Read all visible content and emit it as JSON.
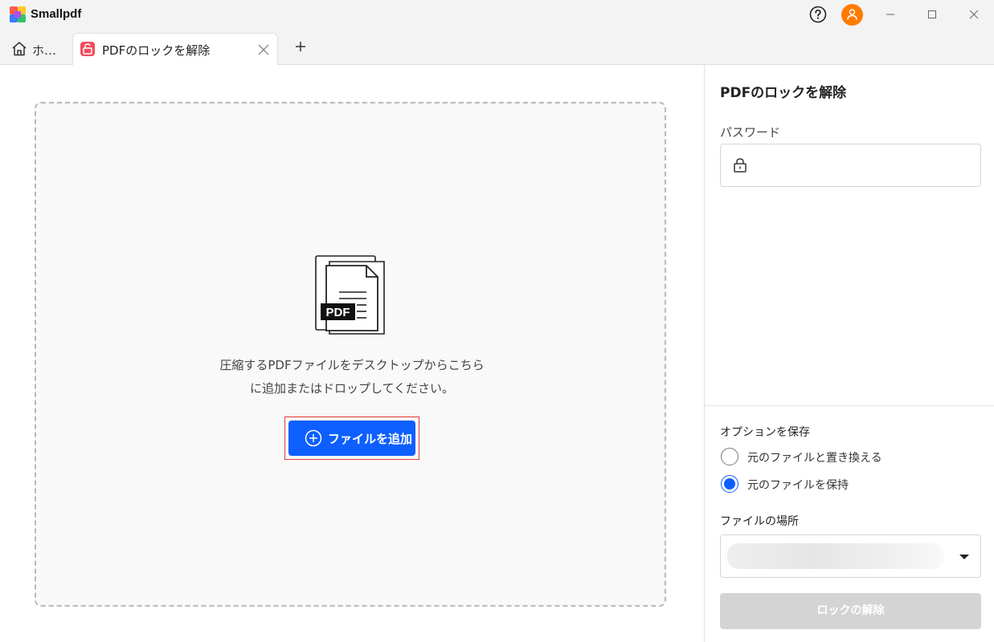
{
  "app": {
    "name": "Smallpdf"
  },
  "tabs": [
    {
      "label": "ホ…",
      "icon": "home-icon"
    },
    {
      "label": "PDFのロックを解除",
      "icon": "unlock-icon",
      "active": true
    }
  ],
  "dropzone": {
    "line1": "圧縮するPDFファイルをデスクトップからこちら",
    "line2": "に追加またはドロップしてください。",
    "illustration_text": "PDF",
    "add_button": "ファイルを追加"
  },
  "panel": {
    "title": "PDFのロックを解除",
    "password_label": "パスワード",
    "password_value": "",
    "save_options_label": "オプションを保存",
    "options": [
      {
        "label": "元のファイルと置き換える",
        "checked": false
      },
      {
        "label": "元のファイルを保持",
        "checked": true
      }
    ],
    "location_label": "ファイルの場所",
    "unlock_button": "ロックの解除"
  },
  "colors": {
    "accent": "#0d5fff",
    "avatar": "#ff7a00",
    "tab_icon": "#f04e5e",
    "disabled_button": "#d4d4d4",
    "highlight": "#e53935"
  }
}
